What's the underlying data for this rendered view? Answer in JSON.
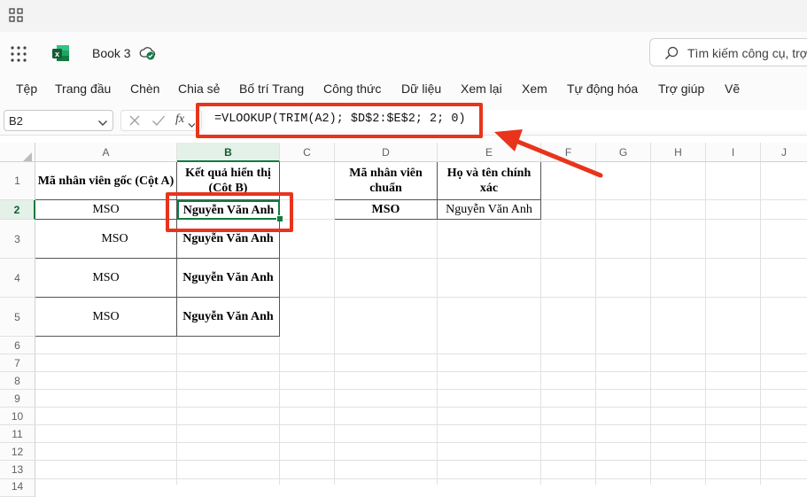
{
  "app": {
    "book_title": "Book 3",
    "search_placeholder": "Tìm kiếm công cụ, trợ"
  },
  "menu": [
    "Tệp",
    "Trang đầu",
    "Chèn",
    "Chia sẻ",
    "Bố trí Trang",
    "Công thức",
    "Dữ liệu",
    "Xem lại",
    "Xem",
    "Tự động hóa",
    "Trợ giúp",
    "Vẽ"
  ],
  "formula_bar": {
    "cell_ref": "B2",
    "fx_label": "fx",
    "formula": "=VLOOKUP(TRIM(A2); $D$2:$E$2; 2; 0)"
  },
  "columns": [
    "A",
    "B",
    "C",
    "D",
    "E",
    "F",
    "G",
    "H",
    "I",
    "J"
  ],
  "rows": [
    "1",
    "2",
    "3",
    "4",
    "5",
    "6",
    "7",
    "8",
    "9",
    "10",
    "11",
    "12",
    "13",
    "14"
  ],
  "cells": {
    "A1": "Mã nhân viên gốc (Cột A)",
    "B1": "Kết quả hiển thị (Cột B)",
    "D1": "Mã nhân viên chuẩn",
    "E1": "Họ và tên chính xác",
    "A2": "MSO",
    "B2": "Nguyễn Văn Anh",
    "D2": "MSO",
    "E2": "Nguyễn Văn Anh",
    "A3": "MSO",
    "B3": "Nguyễn Văn Anh",
    "A4": "MSO",
    "B4": "Nguyễn Văn Anh",
    "A5": "MSO",
    "B5": "Nguyễn Văn Anh"
  },
  "colors": {
    "accent_green": "#107c41",
    "annotation_red": "#e8341c"
  }
}
